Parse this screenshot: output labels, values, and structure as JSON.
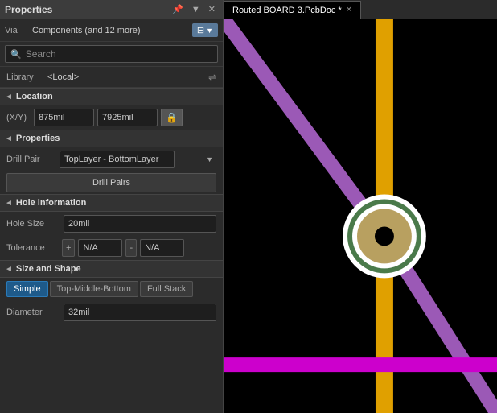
{
  "panel": {
    "title": "Properties",
    "header_icons": [
      "▼",
      "▲",
      "✕"
    ]
  },
  "via_row": {
    "label": "Via",
    "value": "Components (and 12 more)",
    "filter_label": "▼"
  },
  "search": {
    "placeholder": "Search"
  },
  "library": {
    "label": "Library",
    "value": "<Local>",
    "link_icon": "⇌"
  },
  "location": {
    "section_label": "Location",
    "xy_label": "(X/Y)",
    "x_value": "875mil",
    "y_value": "7925mil",
    "lock_icon": "🔒"
  },
  "properties": {
    "section_label": "Properties",
    "drill_pair_label": "Drill Pair",
    "drill_pair_value": "TopLayer - BottomLayer",
    "drill_pairs_btn": "Drill Pairs"
  },
  "hole_info": {
    "section_label": "Hole information",
    "hole_size_label": "Hole Size",
    "hole_size_value": "20mil",
    "tolerance_label": "Tolerance",
    "plus_sign": "+",
    "minus_sign": "-",
    "tol_plus_value": "N/A",
    "tol_minus_value": "N/A"
  },
  "size_shape": {
    "section_label": "Size and Shape",
    "tabs": [
      "Simple",
      "Top-Middle-Bottom",
      "Full Stack"
    ],
    "active_tab": 0,
    "diameter_label": "Diameter",
    "diameter_value": "32mil"
  },
  "tab": {
    "title": "Routed BOARD 3.PcbDoc *"
  },
  "colors": {
    "purple_trace": "#9b59b6",
    "magenta_trace": "#cc00cc",
    "yellow_trace": "#f0a000",
    "via_outer": "#ffffff",
    "via_ring": "#4a7a4a",
    "via_center": "#b8a060",
    "background": "#000000"
  }
}
